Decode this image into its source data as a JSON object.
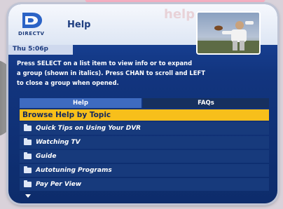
{
  "header": {
    "brand": "DIRECTV",
    "title": "Help",
    "section_word": "help",
    "time": "Thu 5:06p"
  },
  "instructions": [
    "Press SELECT on a list item to view info or to expand",
    "a group (shown in italics). Press CHAN to scroll and LEFT",
    "to close a group when opened."
  ],
  "tabs": [
    {
      "label": "Help",
      "active": true
    },
    {
      "label": "FAQs",
      "active": false
    }
  ],
  "list": {
    "heading": "Browse Help by Topic",
    "items": [
      {
        "label": "Quick Tips on Using Your DVR",
        "icon": "folder-icon"
      },
      {
        "label": "Watching TV",
        "icon": "folder-icon"
      },
      {
        "label": "Guide",
        "icon": "folder-icon"
      },
      {
        "label": "Autotuning Programs",
        "icon": "folder-icon"
      },
      {
        "label": "Pay Per View",
        "icon": "folder-icon"
      }
    ],
    "more_indicator": "scroll-down-arrow-icon"
  },
  "colors": {
    "highlight": "#f7bf1b",
    "row": "#173a7c",
    "tab_active": "#3e6bc0",
    "tab_inactive": "#16305f"
  }
}
